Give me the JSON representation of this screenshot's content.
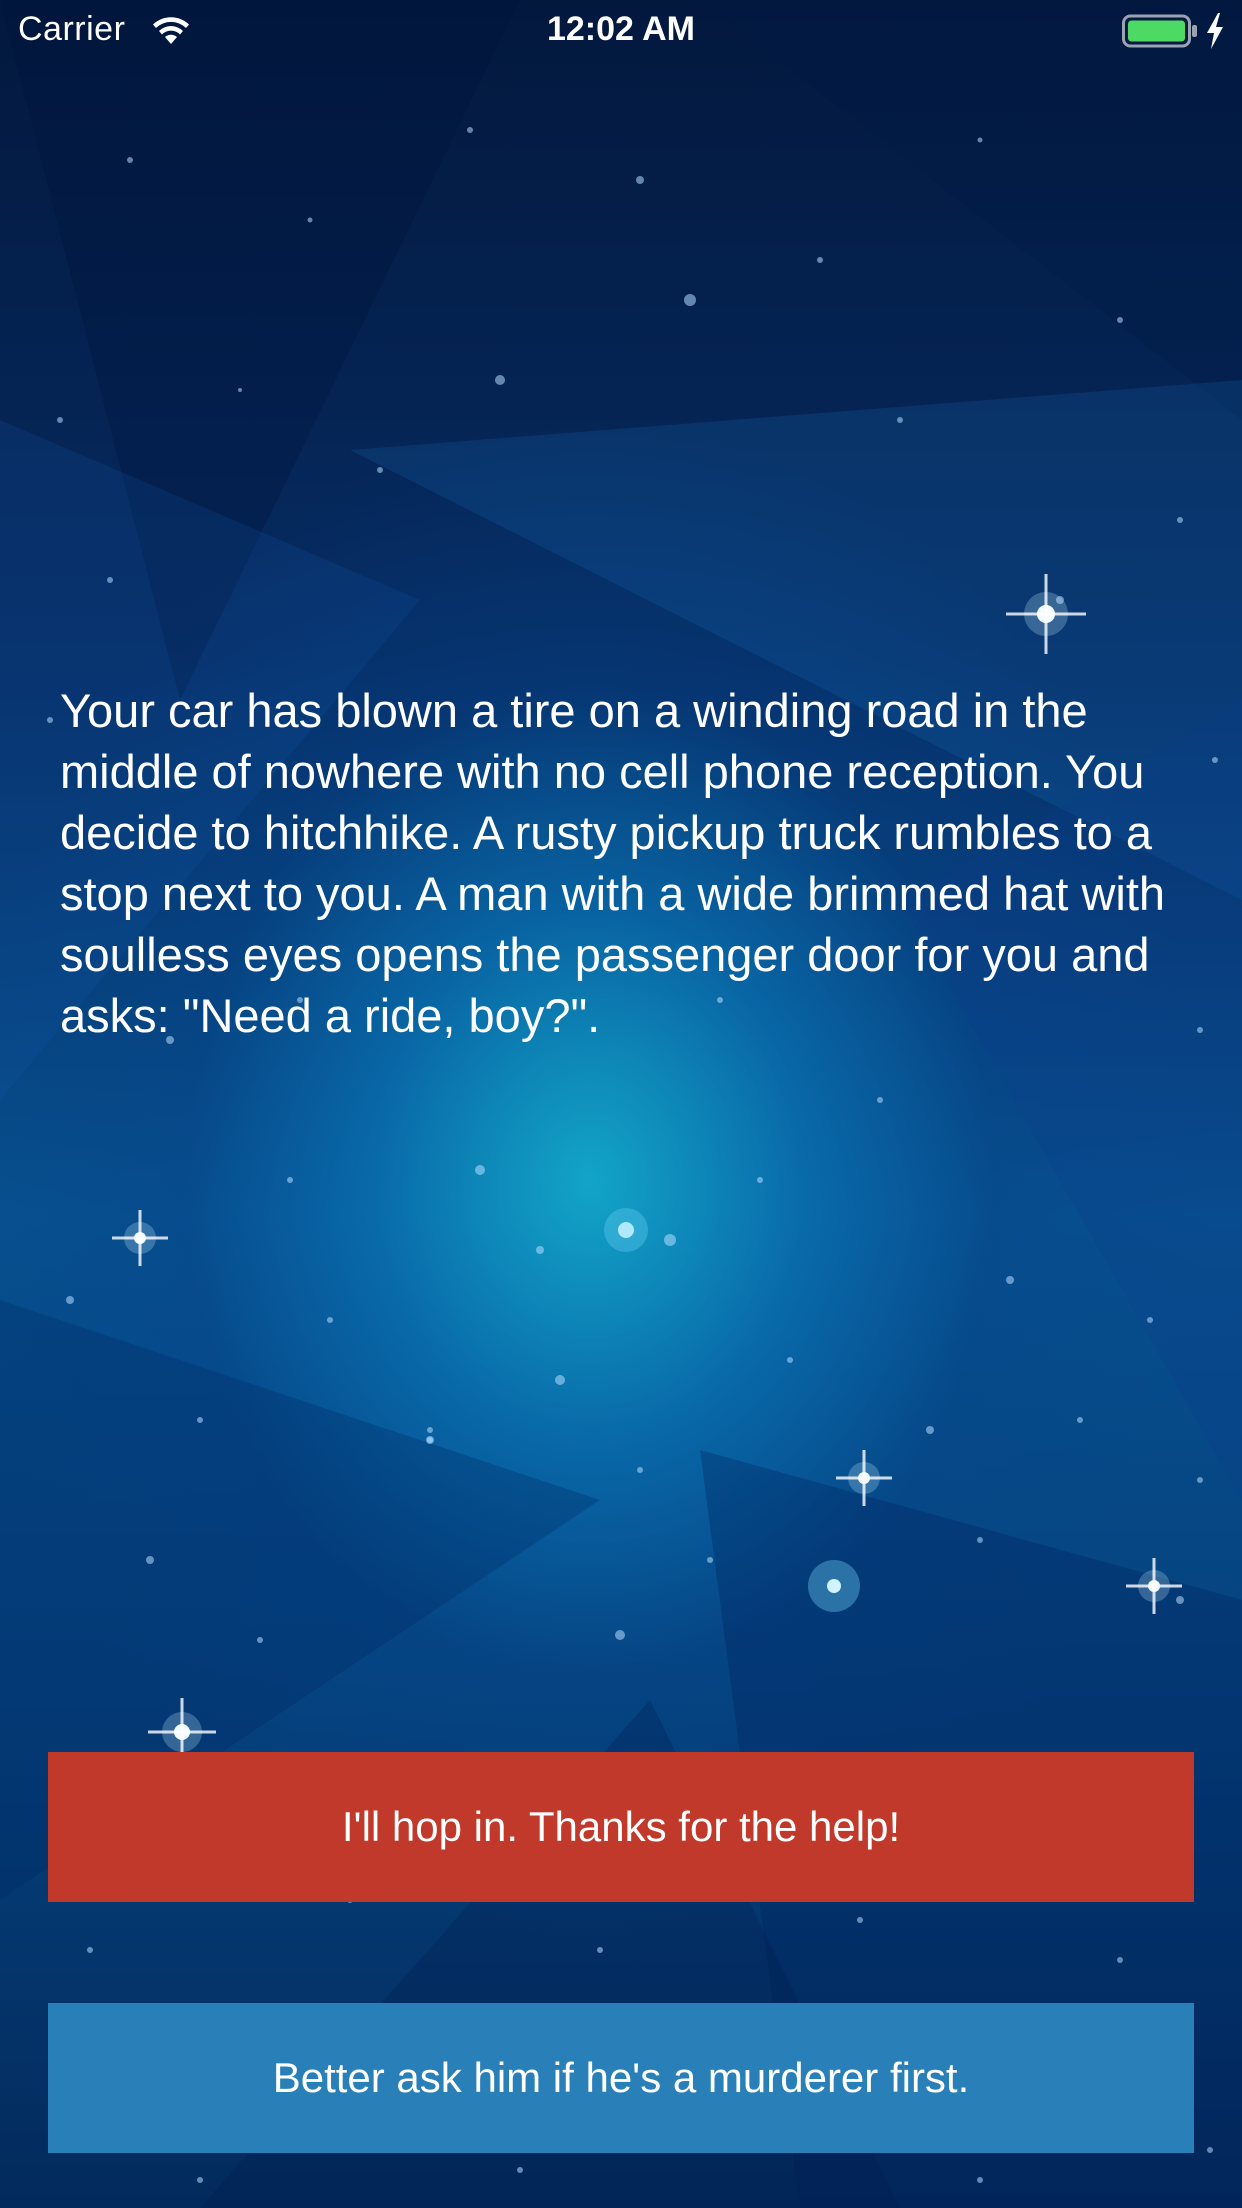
{
  "status_bar": {
    "carrier": "Carrier",
    "time": "12:02 AM",
    "wifi_icon": "wifi-icon",
    "battery_icon": "battery-icon",
    "charging_icon": "charging-bolt-icon",
    "battery_level": 1.0,
    "battery_color": "#4cd964"
  },
  "story": {
    "text": "Your car has blown a tire on a winding road in the middle of nowhere with no cell phone reception. You decide to hitchhike. A rusty pickup truck rumbles to a stop next to you. A man with a wide brimmed hat with soulless eyes opens the passenger door for you and asks: \"Need a ride, boy?\"."
  },
  "choices": {
    "top_label": "I'll hop in. Thanks for the help!",
    "bottom_label": "Better ask him if he's a murderer first.",
    "top_color": "#c0392b",
    "bottom_color": "#2980b9"
  },
  "background": {
    "theme": "starry-blue-space"
  }
}
